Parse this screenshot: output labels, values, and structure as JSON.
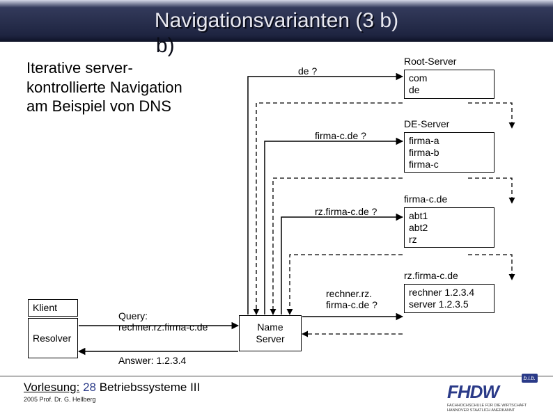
{
  "title": "Navigationsvarianten (3 b)",
  "intro": "Iterative server-kontrollierte Navigation am Beispiel von DNS",
  "klient": "Klient",
  "resolver": "Resolver",
  "nameserver": "Name\nServer",
  "query_label": "Query:\nrechner.rz.firma-c.de",
  "answer_label": "Answer: 1.2.3.4",
  "servers": {
    "root": {
      "title": "Root-Server",
      "items": "com\nde"
    },
    "de": {
      "title": "DE-Server",
      "items": "firma-a\nfirma-b\nfirma-c"
    },
    "fc": {
      "title": "firma-c.de",
      "items": "abt1\nabt2\nrz"
    },
    "rz": {
      "title": "rz.firma-c.de",
      "items": "rechner 1.2.3.4\nserver 1.2.3.5"
    }
  },
  "queries": {
    "q1": "de ?",
    "q2": "firma-c.de ?",
    "q3": "rz.firma-c.de ?",
    "q4": "rechner.rz.\nfirma-c.de ?"
  },
  "footer": {
    "lecture_label": "Vorlesung:",
    "lecture_num": " 28 ",
    "lecture_title": "Betriebssysteme III",
    "copyright": "2005 Prof. Dr. G. Hellberg",
    "logo_text": "FHDW",
    "logo_bib": "b.i.b.",
    "logo_sub1": "FACHHOCHSCHULE FÜR DIE WIRTSCHAFT",
    "logo_sub2": "HANNOVER          STAATLICH ANERKANNT"
  }
}
